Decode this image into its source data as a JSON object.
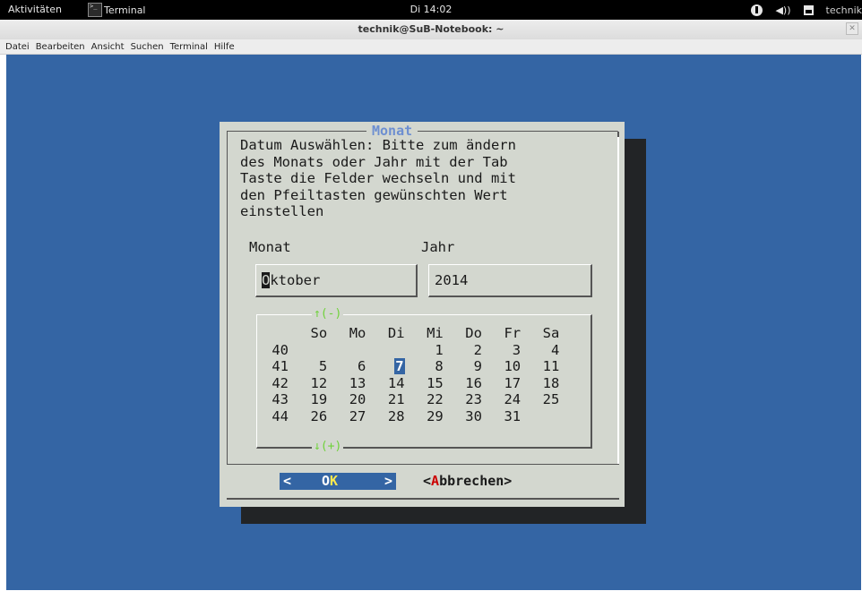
{
  "topbar": {
    "activities": "Aktivitäten",
    "app_name": "Terminal",
    "clock": "Di 14:02",
    "user": "technik"
  },
  "window": {
    "title": "technik@SuB-Notebook: ~",
    "menu": [
      "Datei",
      "Bearbeiten",
      "Ansicht",
      "Suchen",
      "Terminal",
      "Hilfe"
    ]
  },
  "dialog": {
    "title": "Monat",
    "prompt": "Datum Auswählen: Bitte zum ändern\ndes Monats oder Jahr mit der Tab\nTaste die Felder wechseln und mit\nden Pfeiltasten gewünschten Wert\neinstellen",
    "month_label": "Monat",
    "year_label": "Jahr",
    "month_first": "O",
    "month_rest": "ktober",
    "year_value": "2014",
    "scroll_up": "↑(-)",
    "scroll_down": "↓(+)",
    "weekdays": [
      "So",
      "Mo",
      "Di",
      "Mi",
      "Do",
      "Fr",
      "Sa"
    ],
    "weeks": [
      {
        "wk": "40",
        "days": [
          "",
          "",
          "",
          "1",
          "2",
          "3",
          "4"
        ]
      },
      {
        "wk": "41",
        "days": [
          "5",
          "6",
          "7",
          "8",
          "9",
          "10",
          "11"
        ]
      },
      {
        "wk": "42",
        "days": [
          "12",
          "13",
          "14",
          "15",
          "16",
          "17",
          "18"
        ]
      },
      {
        "wk": "43",
        "days": [
          "19",
          "20",
          "21",
          "22",
          "23",
          "24",
          "25"
        ]
      },
      {
        "wk": "44",
        "days": [
          "26",
          "27",
          "28",
          "29",
          "30",
          "31",
          ""
        ]
      }
    ],
    "selected_day": "7",
    "ok_left": "<",
    "ok_hot": "O",
    "ok_rest": "K",
    "ok_right": ">",
    "cancel_pre": "<",
    "cancel_hot": "A",
    "cancel_rest": "bbrechen>"
  },
  "colors": {
    "terminal_bg": "#3465a4",
    "dialog_bg": "#d3d7cf",
    "title_color": "#6d8fd1",
    "scroll_color": "#6fd23a",
    "hotkey_yellow": "#fce94f",
    "hotkey_red": "#cc0000"
  }
}
